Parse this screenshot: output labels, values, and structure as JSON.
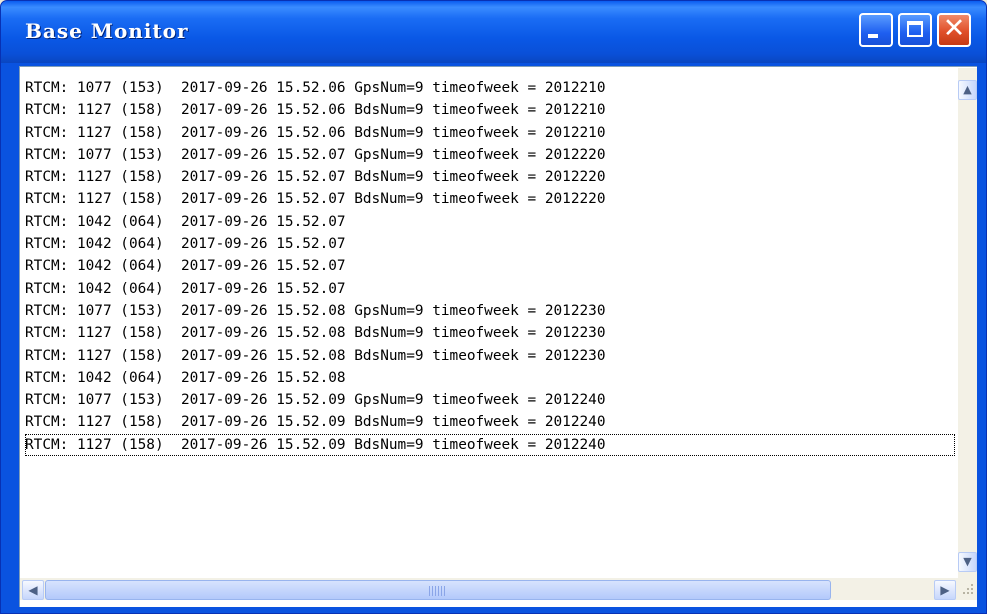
{
  "window": {
    "title": "Base Monitor"
  },
  "controls": {
    "minimize": "minimize-icon",
    "maximize": "maximize-icon",
    "close": "close-icon",
    "close_glyph": "✕"
  },
  "log_lines": [
    "RTCM: 1077 (153)  2017-09-26 15.52.06 GpsNum=9 timeofweek = 2012210",
    "RTCM: 1127 (158)  2017-09-26 15.52.06 BdsNum=9 timeofweek = 2012210",
    "RTCM: 1127 (158)  2017-09-26 15.52.06 BdsNum=9 timeofweek = 2012210",
    "RTCM: 1077 (153)  2017-09-26 15.52.07 GpsNum=9 timeofweek = 2012220",
    "RTCM: 1127 (158)  2017-09-26 15.52.07 BdsNum=9 timeofweek = 2012220",
    "RTCM: 1127 (158)  2017-09-26 15.52.07 BdsNum=9 timeofweek = 2012220",
    "RTCM: 1042 (064)  2017-09-26 15.52.07",
    "RTCM: 1042 (064)  2017-09-26 15.52.07",
    "RTCM: 1042 (064)  2017-09-26 15.52.07",
    "RTCM: 1042 (064)  2017-09-26 15.52.07",
    "RTCM: 1077 (153)  2017-09-26 15.52.08 GpsNum=9 timeofweek = 2012230",
    "RTCM: 1127 (158)  2017-09-26 15.52.08 BdsNum=9 timeofweek = 2012230",
    "RTCM: 1127 (158)  2017-09-26 15.52.08 BdsNum=9 timeofweek = 2012230",
    "RTCM: 1042 (064)  2017-09-26 15.52.08",
    "RTCM: 1077 (153)  2017-09-26 15.52.09 GpsNum=9 timeofweek = 2012240",
    "RTCM: 1127 (158)  2017-09-26 15.52.09 BdsNum=9 timeofweek = 2012240",
    "RTCM: 1127 (158)  2017-09-26 15.52.09 BdsNum=9 timeofweek = 2012240"
  ],
  "focused_line": 16,
  "scroll": {
    "up_glyph": "▲",
    "down_glyph": "▼",
    "left_glyph": "◀",
    "right_glyph": "▶",
    "vertical_position": 1.0,
    "horizontal_position": 0.0
  },
  "colors": {
    "title_bar": "#0a58e6",
    "close_button": "#e0502a",
    "content_bg": "#ffffff"
  }
}
